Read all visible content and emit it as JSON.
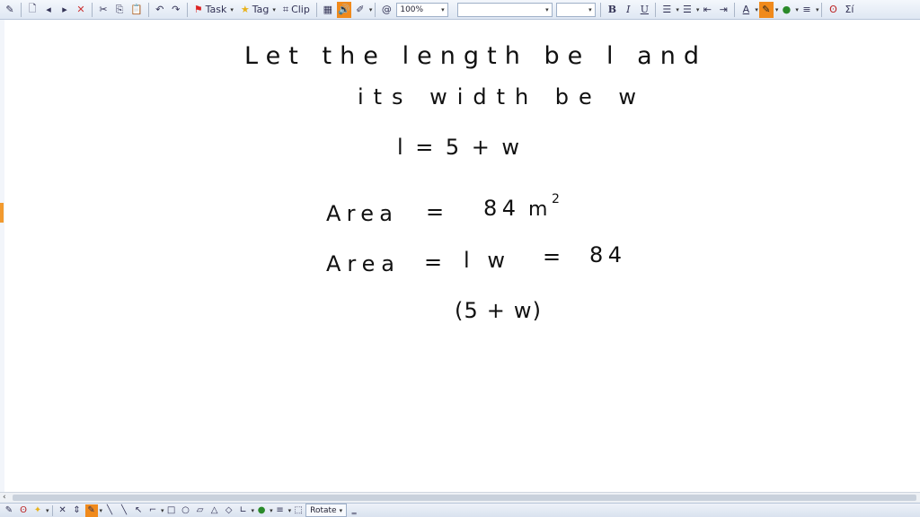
{
  "toolbar": {
    "task_label": "Task",
    "tag_label": "Tag",
    "clip_label": "Clip",
    "zoom_value": "100%",
    "font_name_value": "",
    "font_size_value": "",
    "bold_label": "B",
    "italic_label": "I",
    "underline_label": "U",
    "font_color_label": "A",
    "far_right_label": "Σí"
  },
  "handwriting": {
    "line1": "Let the length be l and",
    "line2": "its width be w",
    "line3": "l = 5 + w",
    "line4_word": "Area",
    "line4_eq": "=",
    "line4_value": "84",
    "line4_unit": "m",
    "line4_exp": "2",
    "line5_word": "Area",
    "line5_eq1": "=",
    "line5_prod": "lw",
    "line5_eq2": "=",
    "line5_value": "84",
    "line6": "(5 + w)"
  },
  "bottom_toolbar": {
    "rotate_label": "Rotate"
  },
  "colors": {
    "accent_orange": "#f08a1c",
    "toolbar_bg": "#dfe7f3",
    "ink": "#111111"
  }
}
